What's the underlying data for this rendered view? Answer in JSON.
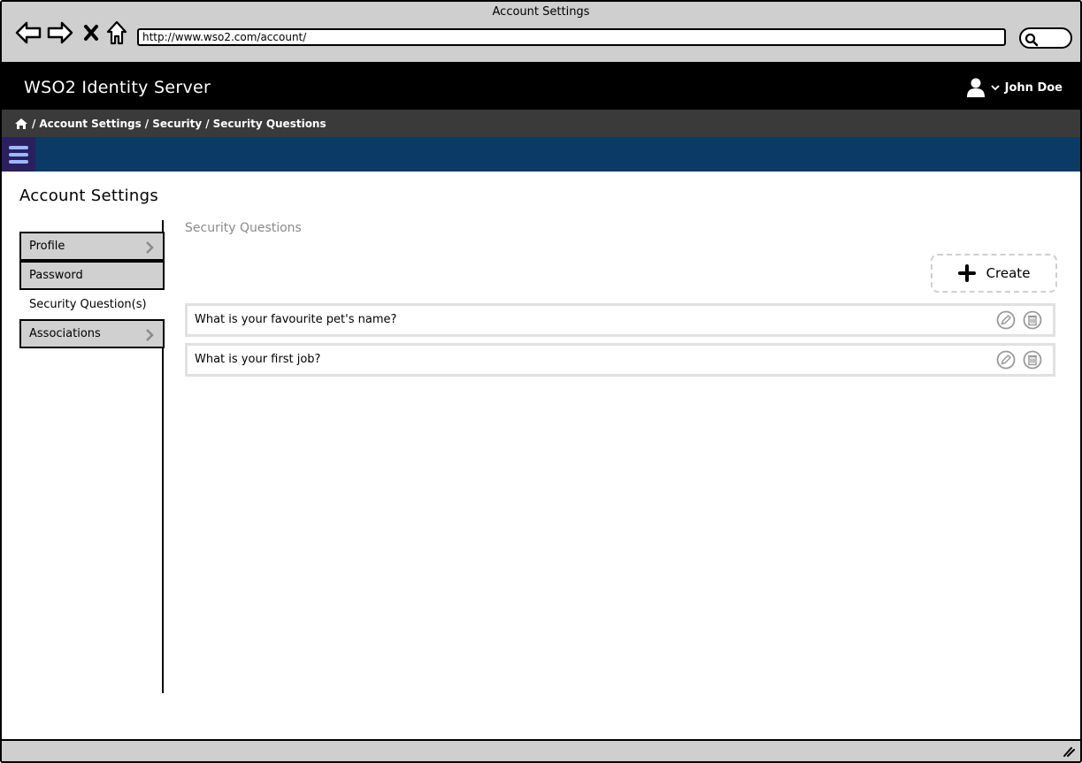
{
  "window": {
    "title": "Account Settings"
  },
  "browser": {
    "url": "http://www.wso2.com/account/",
    "back_icon": "back-arrow-icon",
    "forward_icon": "forward-arrow-icon",
    "stop_icon": "close-icon",
    "home_icon": "home-icon",
    "search_icon": "search-icon"
  },
  "header": {
    "app_title": "WSO2 Identity Server",
    "user_name": "John Doe"
  },
  "breadcrumb": {
    "items": [
      "Account Settings",
      "Security",
      "Security Questions"
    ],
    "separator": "/"
  },
  "page": {
    "title": "Account Settings"
  },
  "sidebar": {
    "items": [
      {
        "label": "Profile",
        "has_chevron": true,
        "active": false
      },
      {
        "label": "Password",
        "has_chevron": false,
        "active": false
      },
      {
        "label": "Security Question(s)",
        "has_chevron": false,
        "active": true
      },
      {
        "label": "Associations",
        "has_chevron": true,
        "active": false
      }
    ]
  },
  "main": {
    "section_label": "Security Questions",
    "create_label": "Create",
    "questions": [
      {
        "text": "What is your favourite pet's name?"
      },
      {
        "text": "What is your first job?"
      }
    ]
  },
  "colors": {
    "header_bg": "#000000",
    "breadcrumb_bg": "#3a3a3a",
    "nav_bg": "#0b3a66",
    "hamburger_bg": "#2a2060"
  }
}
